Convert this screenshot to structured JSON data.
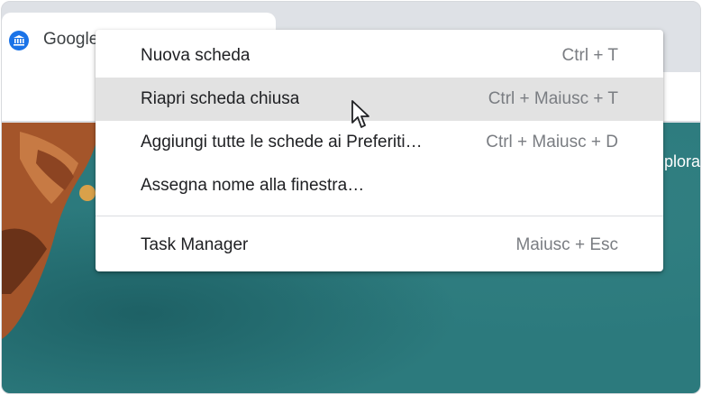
{
  "tab": {
    "title": "Google",
    "favicon": "museum-icon"
  },
  "background": {
    "explore_text": "plora"
  },
  "menu": {
    "items": [
      {
        "label": "Nuova scheda",
        "shortcut": "Ctrl + T",
        "highlighted": false
      },
      {
        "label": "Riapri scheda chiusa",
        "shortcut": "Ctrl + Maiusc + T",
        "highlighted": true
      },
      {
        "label": "Aggiungi tutte le schede ai Preferiti…",
        "shortcut": "Ctrl + Maiusc + D",
        "highlighted": false
      },
      {
        "label": "Assegna nome alla finestra…",
        "shortcut": "",
        "highlighted": false
      },
      {
        "label": "Task Manager",
        "shortcut": "Maiusc + Esc",
        "highlighted": false
      }
    ]
  },
  "colors": {
    "content_bg": "#2c7a7d",
    "highlight": "#e2e2e2",
    "accent": "#1a73e8"
  }
}
